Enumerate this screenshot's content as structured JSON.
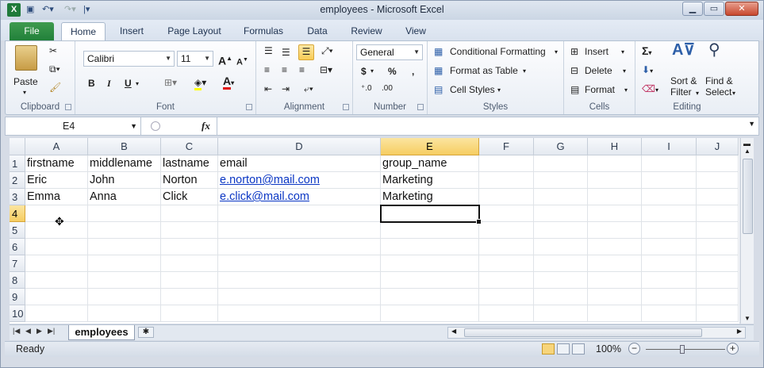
{
  "app": {
    "window_title": "employees - Microsoft Excel",
    "logo_letter": "X"
  },
  "ribbon_tabs": [
    "File",
    "Home",
    "Insert",
    "Page Layout",
    "Formulas",
    "Data",
    "Review",
    "View"
  ],
  "ribbon": {
    "clipboard": {
      "paste_label": "Paste",
      "group_label": "Clipboard"
    },
    "font": {
      "font_name": "Calibri",
      "font_size": "11",
      "bold": "B",
      "italic": "I",
      "underline": "U",
      "group_label": "Font"
    },
    "alignment": {
      "group_label": "Alignment"
    },
    "number": {
      "format": "General",
      "currency": "$",
      "percent": "%",
      "comma": ",",
      "group_label": "Number"
    },
    "styles": {
      "conditional": "Conditional Formatting",
      "format_table": "Format as Table",
      "cell_styles": "Cell Styles",
      "group_label": "Styles"
    },
    "cells": {
      "insert": "Insert",
      "delete": "Delete",
      "format": "Format",
      "group_label": "Cells"
    },
    "editing": {
      "sort_filter_1": "Sort &",
      "sort_filter_2": "Filter",
      "find_select_1": "Find &",
      "find_select_2": "Select",
      "group_label": "Editing"
    }
  },
  "formula_bar": {
    "name_box": "E4",
    "fx": "fx",
    "formula": ""
  },
  "columns": [
    "A",
    "B",
    "C",
    "D",
    "E",
    "F",
    "G",
    "H",
    "I",
    "J"
  ],
  "rows": [
    "1",
    "2",
    "3",
    "4",
    "5",
    "6",
    "7",
    "8",
    "9",
    "10"
  ],
  "cells": {
    "r1": [
      "firstname",
      "middlename",
      "lastname",
      "email",
      "group_name"
    ],
    "r2": [
      "Eric",
      "John",
      "Norton",
      "e.norton@mail.com",
      "Marketing"
    ],
    "r3": [
      "Emma",
      "Anna",
      "Click",
      "e.click@mail.com",
      "Marketing"
    ]
  },
  "active_cell": "E4",
  "sheet_tabs": [
    "employees"
  ],
  "status": {
    "ready": "Ready",
    "zoom": "100%"
  }
}
